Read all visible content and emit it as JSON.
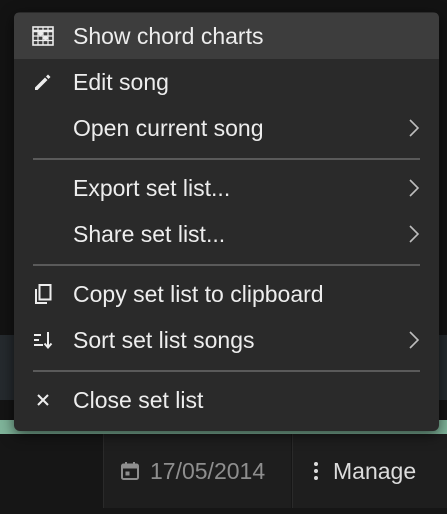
{
  "menu": {
    "items": [
      {
        "label": "Show chord charts",
        "icon": "chord-chart-icon",
        "has_submenu": false,
        "highlighted": true
      },
      {
        "label": "Edit song",
        "icon": "pencil-icon",
        "has_submenu": false,
        "highlighted": false
      },
      {
        "label": "Open current song",
        "icon": "",
        "has_submenu": true,
        "highlighted": false
      },
      {
        "label": "Export set list...",
        "icon": "",
        "has_submenu": true,
        "highlighted": false
      },
      {
        "label": "Share set list...",
        "icon": "",
        "has_submenu": true,
        "highlighted": false
      },
      {
        "label": "Copy set list to clipboard",
        "icon": "copy-icon",
        "has_submenu": false,
        "highlighted": false
      },
      {
        "label": "Sort set list songs",
        "icon": "sort-icon",
        "has_submenu": true,
        "highlighted": false
      },
      {
        "label": "Close set list",
        "icon": "close-icon",
        "has_submenu": false,
        "highlighted": false
      }
    ]
  },
  "bottom_bar": {
    "date": "17/05/2014",
    "date_icon": "calendar-icon",
    "manage_label": "Manage",
    "manage_icon": "more-vertical-icon"
  },
  "colors": {
    "menu_bg": "#2a2a2a",
    "menu_highlight": "#3d3d3d",
    "accent_green": "#7fb49a"
  }
}
